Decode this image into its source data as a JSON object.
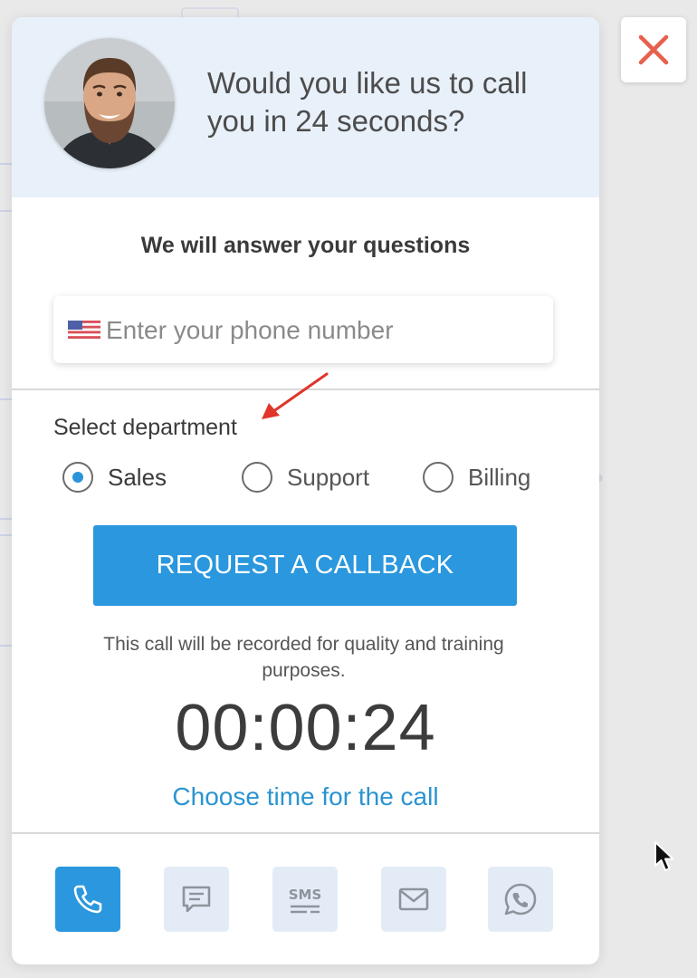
{
  "header": {
    "title": "Would you like us to call you in 24 seconds?",
    "avatar_icon": "agent-avatar"
  },
  "form": {
    "subtitle": "We will answer your questions",
    "phone_placeholder": "Enter your phone number",
    "phone_value": "",
    "flag_icon": "us-flag-icon",
    "department_label": "Select department",
    "departments": [
      {
        "label": "Sales",
        "selected": true
      },
      {
        "label": "Support",
        "selected": false
      },
      {
        "label": "Billing",
        "selected": false
      }
    ],
    "cta_label": "REQUEST A CALLBACK",
    "notice": "This call will be recorded for quality and training purposes.",
    "timer": "00:00:24",
    "choose_time_label": "Choose time for the call"
  },
  "channels": [
    {
      "name": "phone",
      "icon": "phone-icon",
      "active": true
    },
    {
      "name": "chat",
      "icon": "chat-icon",
      "active": false
    },
    {
      "name": "sms",
      "icon": "sms-icon",
      "label": "SMS",
      "active": false
    },
    {
      "name": "email",
      "icon": "mail-icon",
      "active": false
    },
    {
      "name": "whatsapp",
      "icon": "whatsapp-icon",
      "active": false
    }
  ],
  "colors": {
    "accent": "#2a97de",
    "header_bg": "#e8f0f9",
    "close_x": "#e8604c",
    "annotation_arrow": "#e0352b"
  }
}
